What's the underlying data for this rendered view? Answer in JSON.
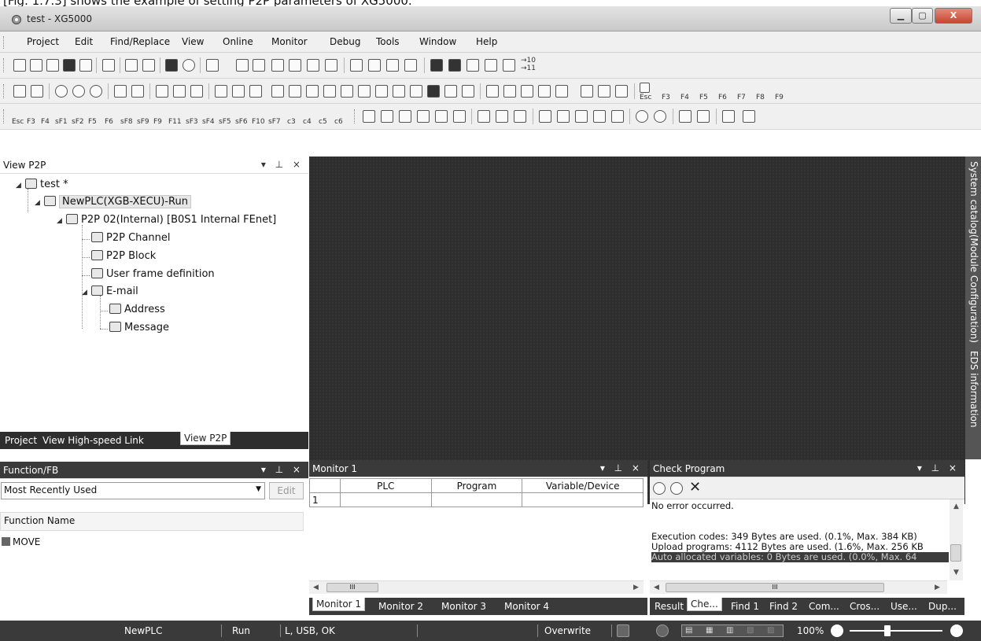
{
  "caption": "[Fig. 1.7.3] shows the example of setting P2P parameters of XG5000.",
  "window": {
    "title": "test - XG5000",
    "min_label": "▁",
    "max_label": "▢",
    "close_label": "X"
  },
  "menu": [
    "Project",
    "Edit",
    "Find/Replace",
    "View",
    "Online",
    "Monitor",
    "Debug",
    "Tools",
    "Window",
    "Help"
  ],
  "toolbar": {
    "row1_text": "→10\n→11",
    "row2_keys": [
      "Esc",
      "F3",
      "F4",
      "F5",
      "F6",
      "F7",
      "F8",
      "F9"
    ],
    "row3_keys": [
      "Esc",
      "F3",
      "F4",
      "sF1",
      "sF2",
      "F5",
      "F6",
      "sF8",
      "sF9",
      "F9",
      "F11",
      "sF3",
      "sF4",
      "sF5",
      "sF6",
      "F10",
      "sF7",
      "c3",
      "c4",
      "c5",
      "c6"
    ]
  },
  "view_p2p": {
    "title": "View P2P",
    "buttons": "▾ ⊥ ×",
    "tree": [
      {
        "label": "test *",
        "icon": "project-icon"
      },
      {
        "label": "NewPLC(XGB-XECU)-Run",
        "icon": "plc-icon"
      },
      {
        "label": "P2P 02(Internal) [B0S1 Internal FEnet]",
        "icon": "network-icon"
      },
      {
        "label": "P2P Channel",
        "icon": "channel-icon"
      },
      {
        "label": "P2P Block",
        "icon": "block-icon"
      },
      {
        "label": "User frame definition",
        "icon": "user-frame-icon"
      },
      {
        "label": "E-mail",
        "icon": "email-icon"
      },
      {
        "label": "Address",
        "icon": "address-book-icon"
      },
      {
        "label": "Message",
        "icon": "message-icon"
      }
    ],
    "tabs": [
      "Project",
      "View High-speed Link",
      "View P2P"
    ]
  },
  "function_fb": {
    "title": "Function/FB",
    "buttons": "▾ ⊥ ×",
    "combo_value": "Most Recently Used",
    "edit_label": "Edit",
    "list_header": "Function Name",
    "items": [
      "MOVE"
    ]
  },
  "monitor": {
    "title": "Monitor 1",
    "buttons": "▾ ⊥ ×",
    "columns": [
      "",
      "PLC",
      "Program",
      "Variable/Device"
    ],
    "rows": [
      [
        "1",
        "",
        "",
        ""
      ]
    ],
    "tabs": [
      "Monitor 1",
      "Monitor 2",
      "Monitor 3",
      "Monitor 4"
    ],
    "scroll_mark": "III"
  },
  "check_program": {
    "title": "Check Program",
    "buttons": "▾ ⊥ ×",
    "lines": [
      "No error occurred.",
      "",
      "",
      "Execution codes: 349 Bytes are used. (0.1%, Max. 384 KB)",
      "Upload programs: 4112 Bytes are used. (1.6%, Max. 256 KB",
      "Auto allocated variables: 0 Bytes are used. (0.0%, Max. 64"
    ],
    "tabs": [
      "Result",
      "Che...",
      "Find 1",
      "Find 2",
      "Com...",
      "Cros...",
      "Use...",
      "Dup..."
    ],
    "scroll_mark": "III"
  },
  "side_strip": [
    "System catalog(Module Configuration)",
    "EDS information"
  ],
  "status": {
    "plc": "NewPLC",
    "state": "Run",
    "conn": "L, USB, OK",
    "mode": "Overwrite",
    "zoom": "100%"
  }
}
